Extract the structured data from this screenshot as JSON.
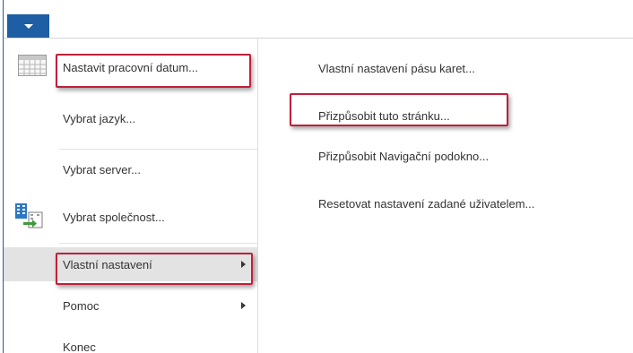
{
  "app_menu": {
    "icon": "caret-down-icon",
    "accent": "#1d5ea4"
  },
  "left_menu": {
    "items": [
      {
        "label": "Nastavit pracovní datum...",
        "icon": "calendar-icon"
      },
      {
        "label": "Vybrat jazyk..."
      },
      {
        "label": "Vybrat server..."
      },
      {
        "label": "Vybrat společnost...",
        "icon": "company-switch-icon"
      },
      {
        "label": "Vlastní nastavení",
        "has_submenu": true,
        "selected": true
      },
      {
        "label": "Pomoc",
        "has_submenu": true
      },
      {
        "label": "Konec"
      }
    ]
  },
  "submenu": {
    "items": [
      {
        "label": "Vlastní nastavení pásu karet..."
      },
      {
        "label": "Přizpůsobit tuto stránku..."
      },
      {
        "label": "Přizpůsobit Navigační podokno..."
      },
      {
        "label": "Resetovat nastavení zadané uživatelem..."
      }
    ]
  },
  "highlight_color": "#c0203a"
}
